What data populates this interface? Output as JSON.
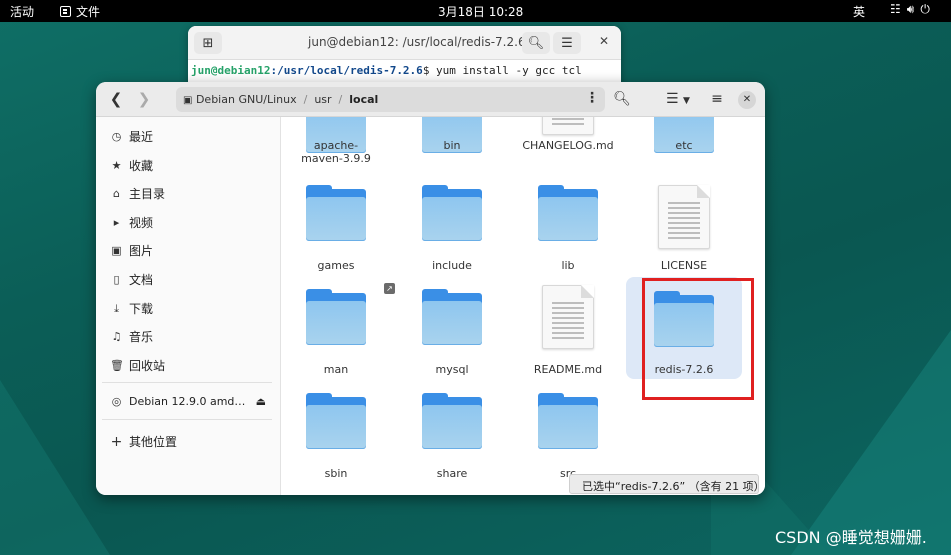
{
  "topbar": {
    "activities": "活动",
    "app_menu": "文件",
    "clock": "3月18日  10:28",
    "input_method": "英",
    "network_icon": "network-icon",
    "volume_icon": "volume-icon",
    "power_icon": "power-icon"
  },
  "terminal": {
    "title": "jun@debian12: /usr/local/redis-7.2.6",
    "prompt_user": "jun@debian12",
    "prompt_path": ":/usr/local/redis-7.2.6",
    "command": "$ yum install -y gcc tcl"
  },
  "files": {
    "path": [
      "Debian GNU/Linux",
      "usr",
      "local"
    ],
    "sidebar": [
      {
        "label": "最近",
        "icon": "clock-icon"
      },
      {
        "label": "收藏",
        "icon": "star-icon"
      },
      {
        "label": "主目录",
        "icon": "home-icon"
      },
      {
        "label": "视频",
        "icon": "video-icon"
      },
      {
        "label": "图片",
        "icon": "image-icon"
      },
      {
        "label": "文档",
        "icon": "document-icon"
      },
      {
        "label": "下载",
        "icon": "download-icon"
      },
      {
        "label": "音乐",
        "icon": "music-icon"
      },
      {
        "label": "回收站",
        "icon": "trash-icon"
      }
    ],
    "device": {
      "label": "Debian 12.9.0 amd…",
      "icon": "disc-icon"
    },
    "other_locations": "其他位置",
    "items": [
      {
        "label": "apache-\nmaven-3.9.9",
        "type": "folder"
      },
      {
        "label": "bin",
        "type": "folder"
      },
      {
        "label": "CHANGELOG.md",
        "type": "document"
      },
      {
        "label": "etc",
        "type": "folder"
      },
      {
        "label": "games",
        "type": "folder"
      },
      {
        "label": "include",
        "type": "folder"
      },
      {
        "label": "lib",
        "type": "folder"
      },
      {
        "label": "LICENSE",
        "type": "document"
      },
      {
        "label": "man",
        "type": "folder-link"
      },
      {
        "label": "mysql",
        "type": "folder"
      },
      {
        "label": "README.md",
        "type": "document"
      },
      {
        "label": "redis-7.2.6",
        "type": "folder",
        "selected": true
      },
      {
        "label": "sbin",
        "type": "folder"
      },
      {
        "label": "share",
        "type": "folder"
      },
      {
        "label": "src",
        "type": "folder"
      }
    ],
    "status": "已选中“redis-7.2.6” （含有 21 项）"
  },
  "watermark": "CSDN @睡觉想姗姗."
}
